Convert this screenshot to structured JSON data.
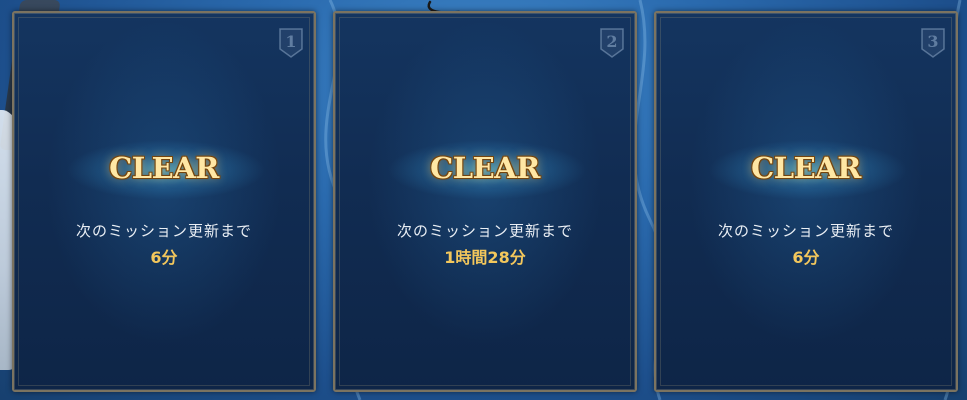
{
  "cards": [
    {
      "number": "1",
      "status": "CLEAR",
      "next_label": "次のミッション更新まで",
      "time": "6分"
    },
    {
      "number": "2",
      "status": "CLEAR",
      "next_label": "次のミッション更新まで",
      "time": "1時間28分"
    },
    {
      "number": "3",
      "status": "CLEAR",
      "next_label": "次のミッション更新まで",
      "time": "6分"
    }
  ],
  "colors": {
    "background": "#2a6aae",
    "card": "#112c52",
    "clear_text": "#ffe7a4",
    "time_text": "#f3c75c",
    "border": "#7b7360"
  },
  "icons": {
    "badge": "shield-number-icon"
  }
}
